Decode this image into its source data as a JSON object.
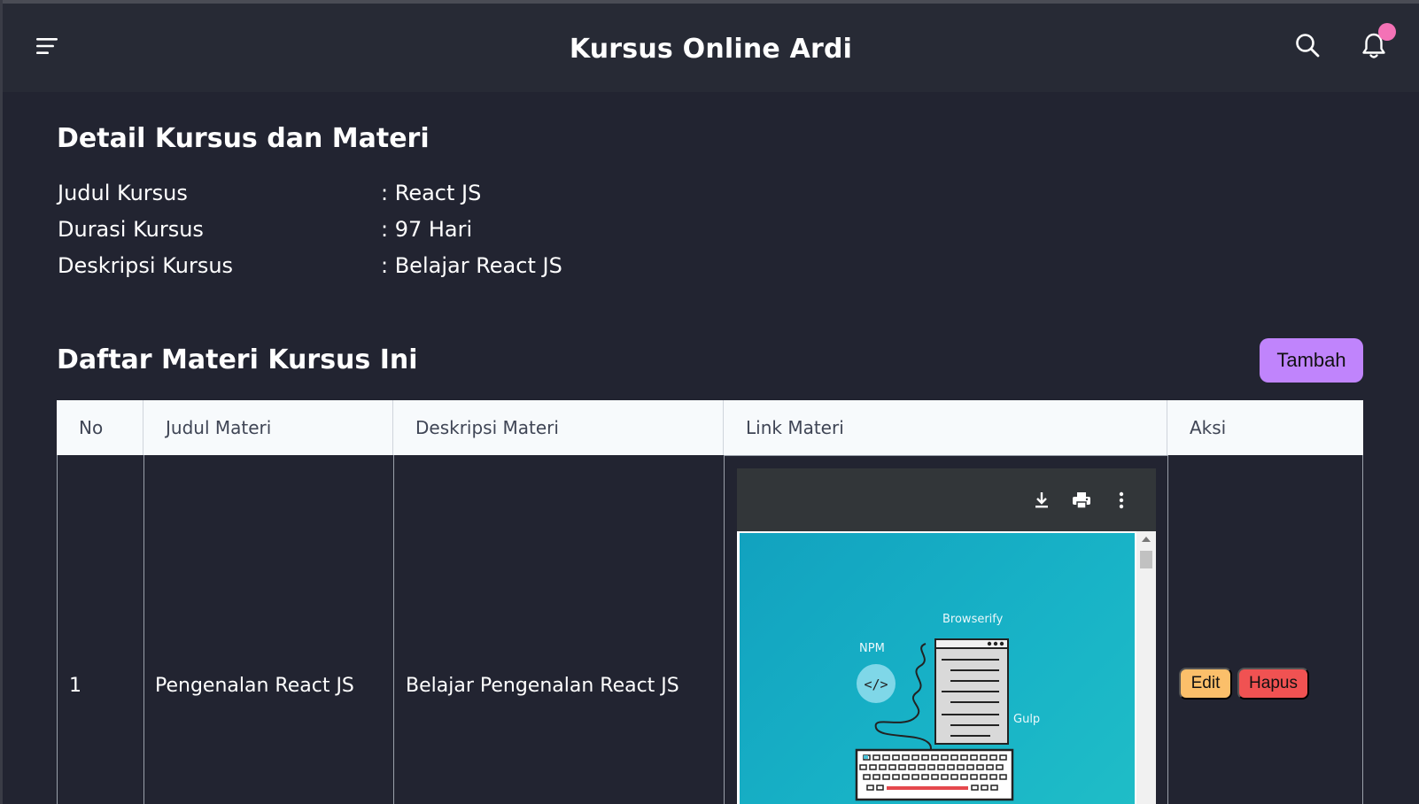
{
  "app": {
    "title": "Kursus Online Ardi"
  },
  "navbar": {
    "menu_icon": "hamburger-icon",
    "search_icon": "search-icon",
    "bell_icon": "bell-icon",
    "notification_dot_color": "#f472b6"
  },
  "detail": {
    "heading": "Detail Kursus dan Materi",
    "rows": [
      {
        "label": "Judul Kursus",
        "value": ": React JS"
      },
      {
        "label": "Durasi Kursus",
        "value": ": 97 Hari"
      },
      {
        "label": "Deskripsi Kursus",
        "value": ": Belajar React JS"
      }
    ]
  },
  "materi": {
    "heading": "Daftar Materi Kursus Ini",
    "add_label": "Tambah",
    "add_color": "#c084fc",
    "columns": [
      "No",
      "Judul Materi",
      "Deskripsi Materi",
      "Link Materi",
      "Aksi"
    ],
    "rows": [
      {
        "no": "1",
        "judul": "Pengenalan React JS",
        "deskripsi": "Belajar Pengenalan React JS",
        "edit_label": "Edit",
        "delete_label": "Hapus"
      }
    ]
  },
  "pdf_viewer": {
    "toolbar_icons": [
      "download-icon",
      "print-icon",
      "more-vertical-icon"
    ],
    "illustration_labels": {
      "browserify": "Browserify",
      "npm": "NPM",
      "gulp": "Gulp"
    }
  },
  "colors": {
    "background": "#222431",
    "navbar": "#272a35",
    "edit": "#fbbf6a",
    "delete": "#f05252"
  }
}
